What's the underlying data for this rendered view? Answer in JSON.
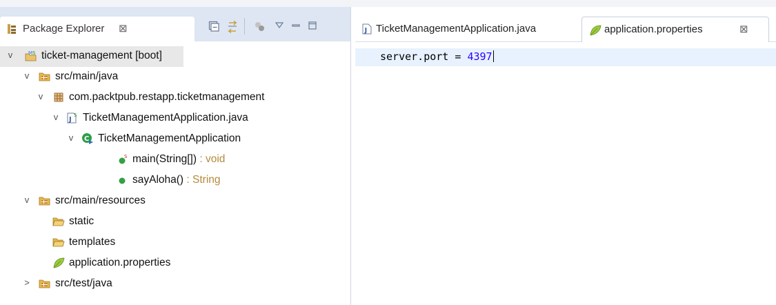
{
  "explorer": {
    "title": "Package Explorer",
    "close_glyph": "⊠",
    "tools": [
      "collapse-all-icon",
      "link-with-editor-icon",
      "focus-icon",
      "view-menu-icon",
      "minimize-icon",
      "maximize-icon"
    ],
    "tree": [
      {
        "label": "ticket-management [boot]",
        "suffix": "",
        "level": 0,
        "arrow": "v",
        "icon": "spring-project-icon",
        "selected": true
      },
      {
        "label": "src/main/java",
        "suffix": "",
        "level": 1,
        "arrow": "v",
        "icon": "source-folder-icon"
      },
      {
        "label": "com.packtpub.restapp.ticketmanagement",
        "suffix": "",
        "level": 2,
        "arrow": "v",
        "icon": "package-icon"
      },
      {
        "label": "TicketManagementApplication.java",
        "suffix": "",
        "level": 3,
        "arrow": "v",
        "icon": "spring-java-file-icon"
      },
      {
        "label": "TicketManagementApplication",
        "suffix": "",
        "level": 4,
        "arrow": "v",
        "icon": "spring-class-icon"
      },
      {
        "label": "main(String[])",
        "suffix": " : void",
        "level": 5,
        "arrow": "",
        "icon": "static-method-icon"
      },
      {
        "label": "sayAloha()",
        "suffix": " : String",
        "level": 5,
        "arrow": "",
        "icon": "public-method-icon"
      },
      {
        "label": "src/main/resources",
        "suffix": "",
        "level": 1,
        "arrow": "v",
        "icon": "source-folder-icon"
      },
      {
        "label": "static",
        "suffix": "",
        "level": 2,
        "arrow": "",
        "icon": "folder-icon"
      },
      {
        "label": "templates",
        "suffix": "",
        "level": 2,
        "arrow": "",
        "icon": "folder-icon"
      },
      {
        "label": "application.properties",
        "suffix": "",
        "level": 2,
        "arrow": "",
        "icon": "properties-leaf-icon"
      },
      {
        "label": "src/test/java",
        "suffix": "",
        "level": 1,
        "arrow": ">",
        "icon": "source-folder-icon"
      }
    ]
  },
  "editor": {
    "tabs": [
      {
        "label": "TicketManagementApplication.java",
        "icon": "java-file-icon",
        "active": false,
        "close": ""
      },
      {
        "label": "application.properties",
        "icon": "properties-leaf-icon",
        "active": true,
        "close": "⊠"
      }
    ],
    "code": {
      "key": "server.port = ",
      "value": "4397"
    }
  },
  "colors": {
    "tabbar": "#dde6f2",
    "current_line": "#e8f2fe",
    "number": "#2a00ff",
    "selection": "#e8e8e8"
  }
}
